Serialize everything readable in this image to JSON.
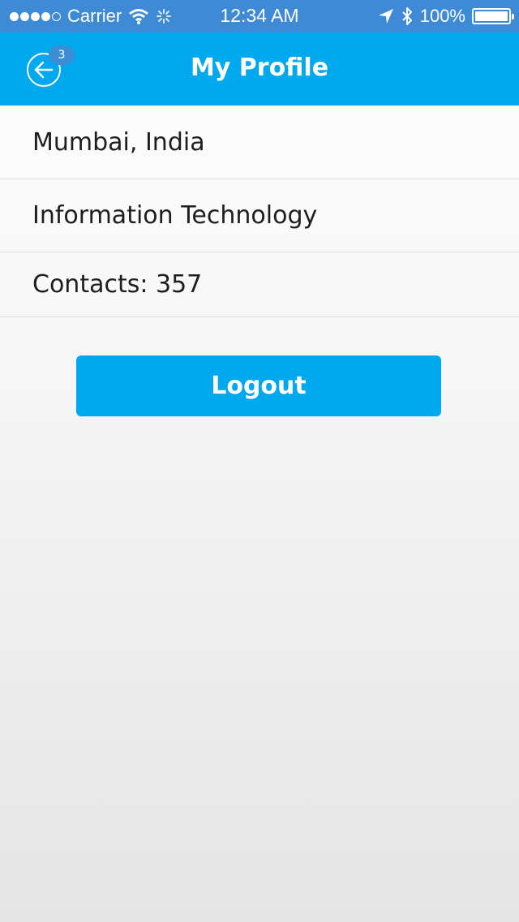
{
  "status_bar": {
    "carrier": "Carrier",
    "time": "12:34 AM",
    "battery": "100%",
    "battery_level": 1.0,
    "icons": [
      "signal-dots-icon",
      "wifi-icon",
      "activity-spinner-icon",
      "location-arrow-icon",
      "bluetooth-icon",
      "battery-icon"
    ]
  },
  "nav": {
    "title": "My Profile",
    "back_badge": "3",
    "back_icon": "back-arrow-circle-icon",
    "accent_color": "#00a9ed"
  },
  "profile": {
    "location": "Mumbai, India",
    "industry": "Information Technology",
    "contacts": "Contacts: 357"
  },
  "actions": {
    "logout_label": "Logout"
  }
}
